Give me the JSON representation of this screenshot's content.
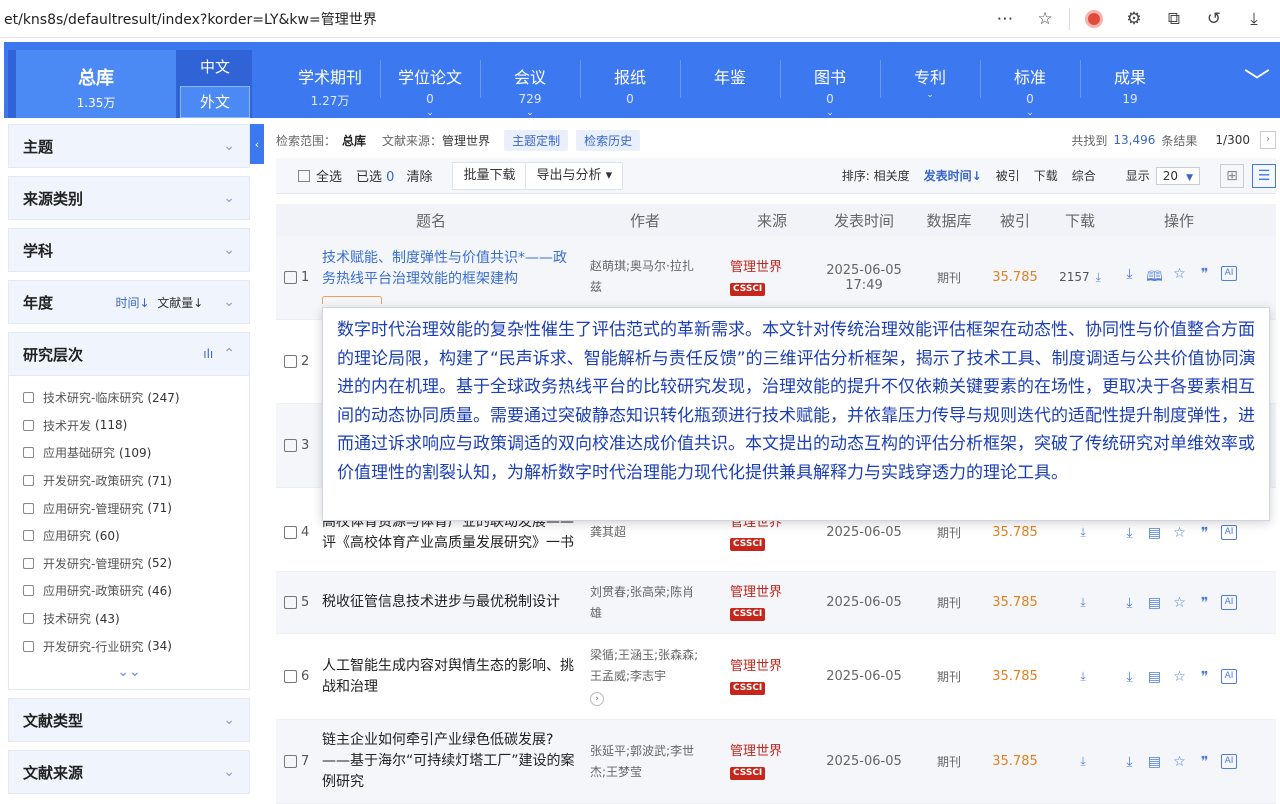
{
  "browser": {
    "url": "et/kns8s/defaultresult/index?korder=LY&kw=管理世界",
    "tools": [
      "more-icon",
      "favorite-icon",
      "profile-icon",
      "extensions-icon",
      "collections-icon",
      "history-icon",
      "download-icon"
    ]
  },
  "nav": {
    "home_title": "总库",
    "home_count": "1.35万",
    "lang_zh": "中文",
    "lang_en": "外文",
    "tabs": [
      {
        "label": "学术期刊",
        "count": "1.27万",
        "chev": ""
      },
      {
        "label": "学位论文",
        "count": "0",
        "chev": "⌄"
      },
      {
        "label": "会议",
        "count": "729",
        "chev": "⌄"
      },
      {
        "label": "报纸",
        "count": "0",
        "chev": ""
      },
      {
        "label": "年鉴",
        "count": "",
        "chev": ""
      },
      {
        "label": "图书",
        "count": "0",
        "chev": "⌄"
      },
      {
        "label": "专利",
        "count": "",
        "chev": "⌄"
      },
      {
        "label": "标准",
        "count": "0",
        "chev": "⌄"
      },
      {
        "label": "成果",
        "count": "19",
        "chev": ""
      }
    ]
  },
  "sidebar": {
    "facets_top": [
      "主题",
      "来源类别",
      "学科"
    ],
    "year": {
      "label": "年度",
      "sort1": "时间↓",
      "sort2": "文献量↓"
    },
    "level": {
      "label": "研究层次",
      "items": [
        {
          "name": "技术研究-临床研究",
          "count": "(247)"
        },
        {
          "name": "技术开发",
          "count": "(118)"
        },
        {
          "name": "应用基础研究",
          "count": "(109)"
        },
        {
          "name": "开发研究-政策研究",
          "count": "(71)"
        },
        {
          "name": "应用研究-管理研究",
          "count": "(71)"
        },
        {
          "name": "应用研究",
          "count": "(60)"
        },
        {
          "name": "开发研究-管理研究",
          "count": "(52)"
        },
        {
          "name": "应用研究-政策研究",
          "count": "(46)"
        },
        {
          "name": "技术研究",
          "count": "(43)"
        },
        {
          "name": "开发研究-行业研究",
          "count": "(34)"
        }
      ]
    },
    "facets_bottom": [
      "文献类型",
      "文献来源"
    ]
  },
  "scope": {
    "label": "检索范围：",
    "scope_value": "总库",
    "source_label": "文献来源：",
    "source_value": "管理世界",
    "btn_custom": "主题定制",
    "btn_history": "检索历史",
    "found_prefix": "共找到",
    "found_count": "13,496",
    "found_suffix": "条结果",
    "page": "1/300"
  },
  "toolbar": {
    "select_all": "全选",
    "selected": "已选",
    "selected_count": "0",
    "clear": "清除",
    "batch_download": "批量下载",
    "export": "导出与分析 ▾",
    "sort_label": "排序:",
    "sort_relevance": "相关度",
    "sort_date": "发表时间↓",
    "sort_cited": "被引",
    "sort_download": "下载",
    "sort_overall": "综合",
    "display_label": "显示",
    "display_value": "20"
  },
  "table": {
    "headers": [
      "题名",
      "作者",
      "来源",
      "发表时间",
      "数据库",
      "被引",
      "下载",
      "操作"
    ],
    "rows": [
      {
        "no": "1",
        "title": "技术赋能、制度弹性与价值共识*——政务热线平台治理效能的框架建构",
        "authors": "赵萌琪;奥马尔·拉扎兹",
        "source": "管理世界",
        "tag": "CSSCI",
        "date": "2025-06-05 17:49",
        "db": "期刊",
        "cited": "35.785",
        "downloads": "2157"
      },
      {
        "no": "2",
        "title": "",
        "authors": "",
        "source": "",
        "tag": "",
        "date": "",
        "db": "",
        "cited": "",
        "downloads": ""
      },
      {
        "no": "3",
        "title": "",
        "authors": "",
        "source": "",
        "tag": "",
        "date": "",
        "db": "",
        "cited": "",
        "downloads": ""
      },
      {
        "no": "4",
        "title": "高校体育资源与体育产业的联动发展——评《高校体育产业高质量发展研究》一书",
        "authors": "龚其超",
        "source": "管理世界",
        "tag": "CSSCI",
        "date": "2025-06-05",
        "db": "期刊",
        "cited": "35.785",
        "downloads": ""
      },
      {
        "no": "5",
        "title": "税收征管信息技术进步与最优税制设计",
        "authors": "刘贯春;张高荣;陈肖雄",
        "source": "管理世界",
        "tag": "CSSCI",
        "date": "2025-06-05",
        "db": "期刊",
        "cited": "35.785",
        "downloads": ""
      },
      {
        "no": "6",
        "title": "人工智能生成内容对舆情生态的影响、挑战和治理",
        "authors": "梁循;王涵玉;张森森;王孟威;李志宇",
        "source": "管理世界",
        "tag": "CSSCI",
        "date": "2025-06-05",
        "db": "期刊",
        "cited": "35.785",
        "downloads": ""
      },
      {
        "no": "7",
        "title": "链主企业如何牵引产业绿色低碳发展?——基于海尔“可持续灯塔工厂”建设的案例研究",
        "authors": "张延平;郭波武;李世杰;王梦莹",
        "source": "管理世界",
        "tag": "CSSCI",
        "date": "2025-06-05",
        "db": "期刊",
        "cited": "35.785",
        "downloads": ""
      }
    ]
  },
  "popup": {
    "abstract": "数字时代治理效能的复杂性催生了评估范式的革新需求。本文针对传统治理效能评估框架在动态性、协同性与价值整合方面的理论局限，构建了“民声诉求、智能解析与责任反馈”的三维评估分析框架，揭示了技术工具、制度调适与公共价值协同演进的内在机理。基于全球政务热线平台的比较研究发现，治理效能的提升不仅依赖关键要素的在场性，更取决于各要素相互间的动态协同质量。需要通过突破静态知识转化瓶颈进行技术赋能，并依靠压力传导与规则迭代的适配性提升制度弹性，进而通过诉求响应与政策调适的双向校准达成价值共识。本文提出的动态互构的评估分析框架，突破了传统研究对单维效率或价值理性的割裂认知，为解析数字时代治理能力现代化提供兼具解释力与实践穿透力的理论工具。"
  }
}
